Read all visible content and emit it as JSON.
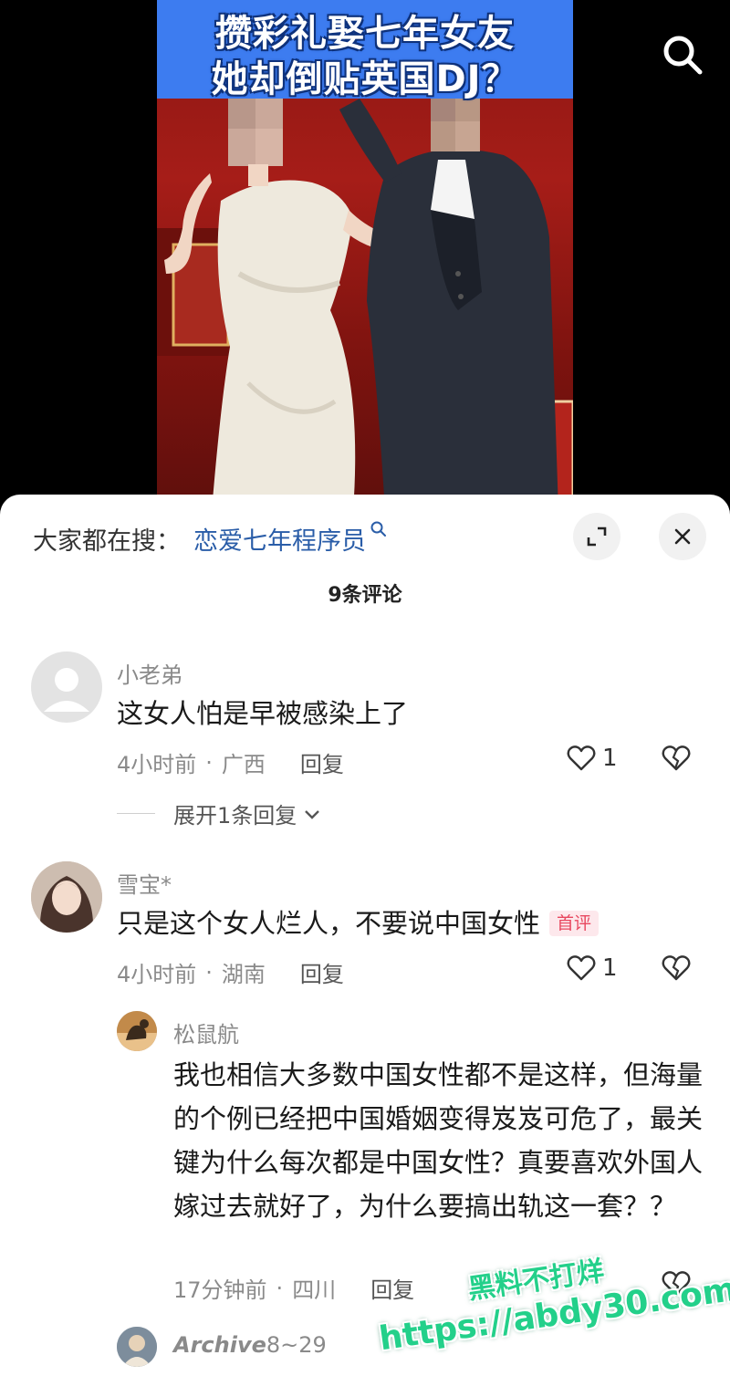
{
  "video": {
    "headline_line1": "攒彩礼娶七年女友",
    "headline_line2": "她却倒贴英国DJ？",
    "search_icon": "search-icon"
  },
  "sheet": {
    "search_hint_label": "大家都在搜：",
    "search_hint_link": "恋爱七年程序员",
    "comment_count": "9条评论",
    "expand_icon": "expand-icon",
    "close_icon": "close-icon"
  },
  "comments": [
    {
      "user": "小老弟",
      "text": "这女人怕是早被感染上了",
      "time": "4小时前",
      "location": "广西",
      "reply_label": "回复",
      "likes": "1",
      "expand_replies": "展开1条回复"
    },
    {
      "user": "雪宝*",
      "text": "只是这个女人烂人，不要说中国女性",
      "badge": "首评",
      "time": "4小时前",
      "location": "湖南",
      "reply_label": "回复",
      "likes": "1"
    }
  ],
  "replies": [
    {
      "user": "松鼠航",
      "text": "我也相信大多数中国女性都不是这样，但海量的个例已经把中国婚姻变得岌岌可危了，最关键为什么每次都是中国女性？真要喜欢外国人嫁过去就好了，为什么要搞出轨这一套？？",
      "time": "17分钟前",
      "location": "四川",
      "reply_label": "回复"
    },
    {
      "user": "Archive",
      "user_suffix": "8~29"
    }
  ],
  "watermark": {
    "line1": "黑料不打烊",
    "line2": "https://abdy30.com"
  },
  "colors": {
    "banner": "#3d7cf0",
    "link": "#2a5da8",
    "badge": "#e8475f",
    "watermark": "#23d08a"
  }
}
